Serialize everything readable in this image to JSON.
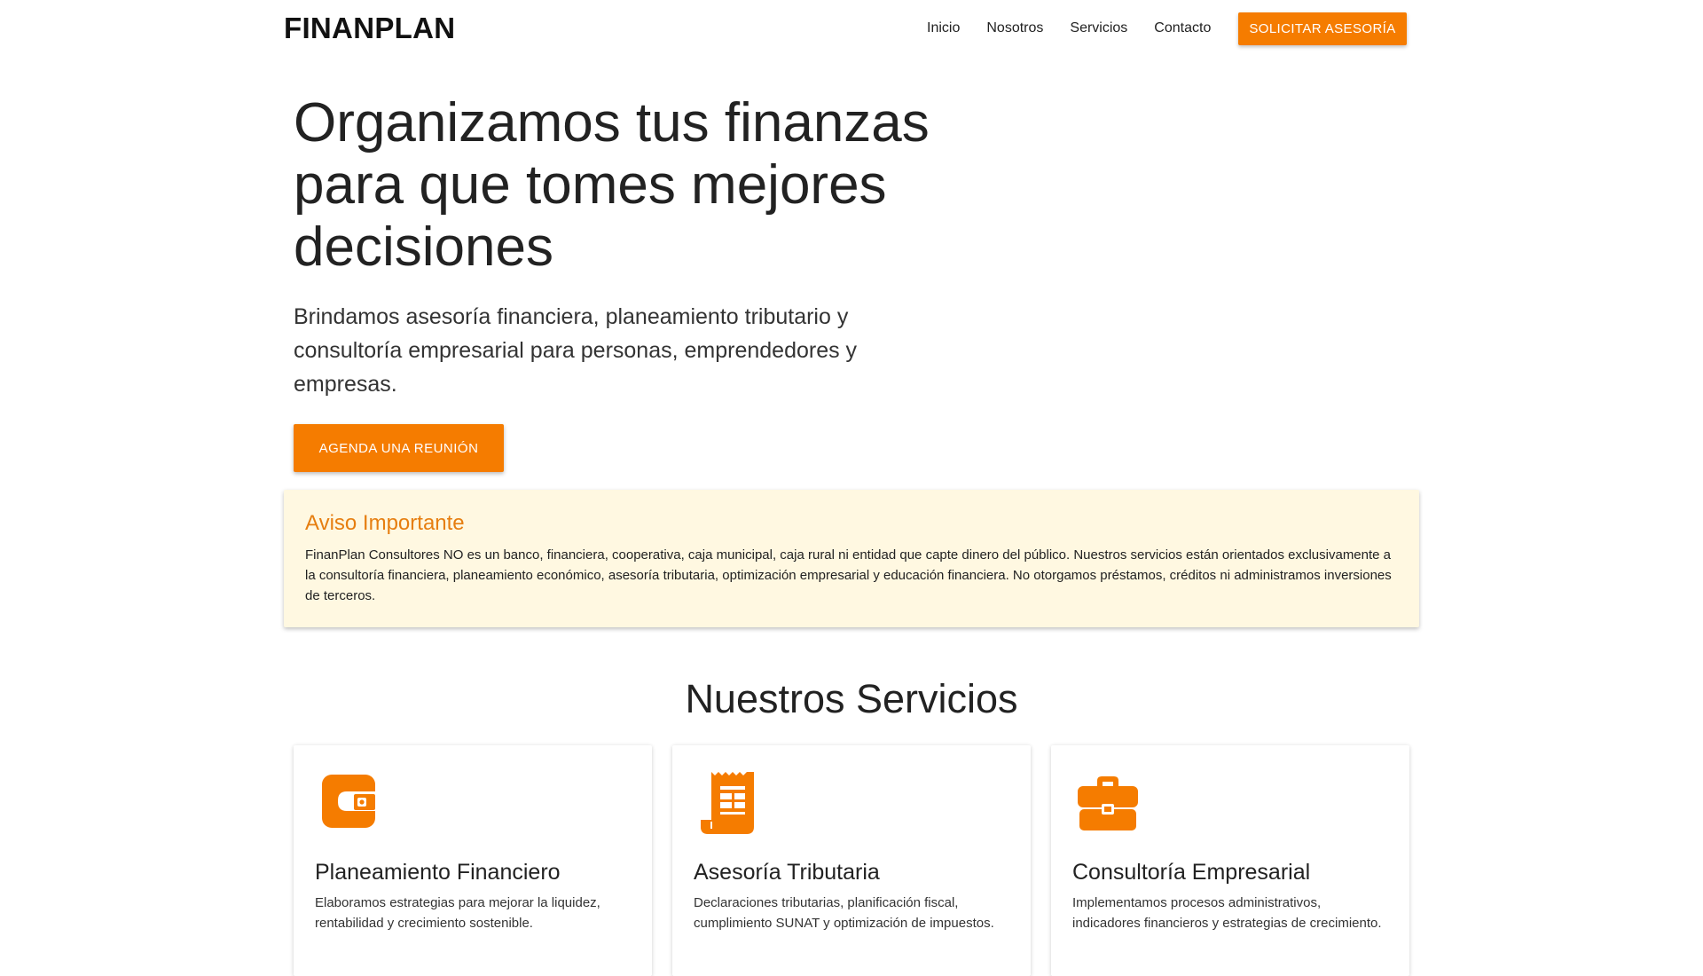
{
  "header": {
    "brand": "FINANPLAN",
    "nav": [
      {
        "label": "Inicio"
      },
      {
        "label": "Nosotros"
      },
      {
        "label": "Servicios"
      },
      {
        "label": "Contacto"
      }
    ],
    "cta_label": "SOLICITAR ASESORÍA"
  },
  "hero": {
    "title": "Organizamos tus finanzas para que tomes mejores decisiones",
    "subtitle": "Brindamos asesoría financiera, planeamiento tributario y consultoría empresarial para personas, emprendedores y empresas.",
    "cta_label": "AGENDA UNA REUNIÓN"
  },
  "notice": {
    "title": "Aviso Importante",
    "text": "FinanPlan Consultores NO es un banco, financiera, cooperativa, caja municipal, caja rural ni entidad que capte dinero del público. Nuestros servicios están orientados exclusivamente a la consultoría financiera, planeamiento económico, asesoría tributaria, optimización empresarial y educación financiera. No otorgamos préstamos, créditos ni administramos inversiones de terceros."
  },
  "services": {
    "title": "Nuestros Servicios",
    "items": [
      {
        "icon": "wallet-icon",
        "title": "Planeamiento Financiero",
        "text": "Elaboramos estrategias para mejorar la liquidez, rentabilidad y crecimiento sostenible."
      },
      {
        "icon": "receipt-icon",
        "title": "Asesoría Tributaria",
        "text": "Declaraciones tributarias, planificación fiscal, cumplimiento SUNAT y optimización de impuestos."
      },
      {
        "icon": "briefcase-icon",
        "title": "Consultoría Empresarial",
        "text": "Implementamos procesos administrativos, indicadores financieros y estrategias de crecimiento."
      }
    ]
  },
  "colors": {
    "accent": "#f57c00",
    "notice_bg": "#fff8e1",
    "notice_title": "#e67e10",
    "text": "#222222"
  }
}
